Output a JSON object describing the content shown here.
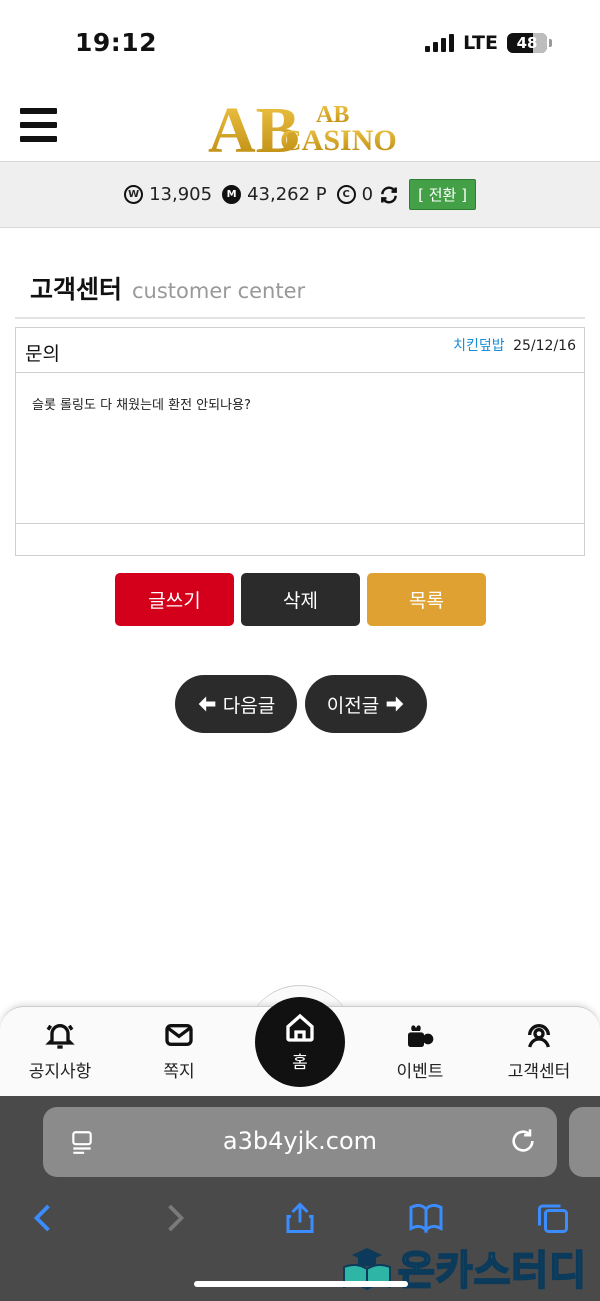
{
  "status_bar": {
    "time": "19:12",
    "network": "LTE",
    "battery": "48"
  },
  "header": {
    "logo_text_top": "AB",
    "logo_text_bottom": "CASINO",
    "logo_monogram": "AB"
  },
  "balance": {
    "won_symbol": "W",
    "won_value": "13,905",
    "mileage_symbol": "M",
    "mileage_value": "43,262 P",
    "casino_symbol": "C",
    "casino_value": "0",
    "convert_label": "[ 전환 ]"
  },
  "page": {
    "title": "고객센터",
    "subtitle": "customer center"
  },
  "post": {
    "title": "문의",
    "author": "치킨덮밥",
    "date": "25/12/16",
    "body": "슬롯 롤링도 다 채웠는데 환전 안되나용?"
  },
  "actions": {
    "write": "글쓰기",
    "delete": "삭제",
    "list": "목록"
  },
  "navigation": {
    "next": "다음글",
    "prev": "이전글"
  },
  "tabbar": {
    "notice": "공지사항",
    "message": "쪽지",
    "home": "홈",
    "event": "이벤트",
    "support": "고객센터"
  },
  "browser": {
    "url": "a3b4yjk.com"
  },
  "watermark": {
    "text": "온카스터디"
  },
  "colors": {
    "write_btn": "#d4001b",
    "delete_btn": "#2b2b2b",
    "list_btn": "#e0a133",
    "convert_btn": "#43a047",
    "author_link": "#1a8fd6",
    "logo_gold": "#d9a521"
  }
}
